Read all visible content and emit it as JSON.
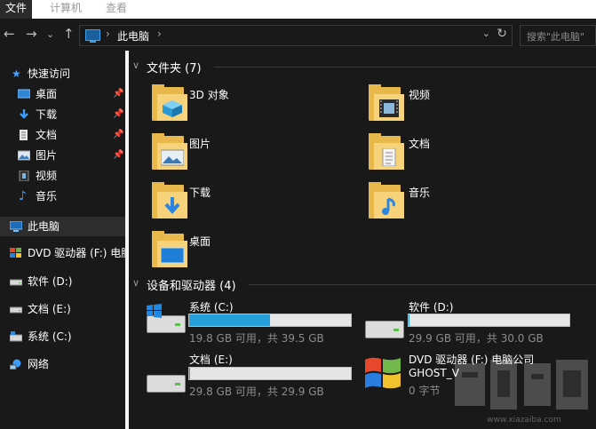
{
  "ribbon": {
    "tabs": [
      "文件",
      "计算机",
      "查看"
    ]
  },
  "navbar": {
    "back": "←",
    "forward": "→",
    "recent": "⌄",
    "up": "↑",
    "address_sep": "›",
    "address_crumb": "此电脑",
    "address_sep2": "›",
    "dropdown": "⌄",
    "refresh": "↻",
    "search_placeholder": "搜索\"此电脑\""
  },
  "sidebar": {
    "quick_access": "快速访问",
    "items": [
      {
        "label": "桌面",
        "icon": "desktop-icon",
        "pinned": true
      },
      {
        "label": "下载",
        "icon": "download-icon",
        "pinned": true
      },
      {
        "label": "文档",
        "icon": "document-icon",
        "pinned": true
      },
      {
        "label": "图片",
        "icon": "picture-icon",
        "pinned": true
      },
      {
        "label": "视频",
        "icon": "video-icon",
        "pinned": false
      },
      {
        "label": "音乐",
        "icon": "music-icon",
        "pinned": false
      }
    ],
    "this_pc": "此电脑",
    "drives": [
      {
        "label": "DVD 驱动器 (F:) 电脑",
        "icon": "dvd-icon"
      },
      {
        "label": "软件 (D:)",
        "icon": "drive-icon"
      },
      {
        "label": "文档 (E:)",
        "icon": "drive-icon"
      },
      {
        "label": "系统 (C:)",
        "icon": "system-drive-icon"
      },
      {
        "label": "网络",
        "icon": "network-icon"
      }
    ],
    "pin_glyph": "📌"
  },
  "folders_section": {
    "title": "文件夹 (7)",
    "chevron": "∨",
    "items": [
      "3D 对象",
      "视频",
      "图片",
      "文档",
      "下载",
      "音乐",
      "桌面"
    ]
  },
  "drives_section": {
    "title": "设备和驱动器 (4)",
    "chevron": "∨",
    "items": [
      {
        "name": "系统 (C:)",
        "info": "19.8 GB 可用，共 39.5 GB",
        "used_fraction": 0.5
      },
      {
        "name": "软件 (D:)",
        "info": "29.9 GB 可用，共 30.0 GB",
        "used_fraction": 0.003
      },
      {
        "name": "文档 (E:)",
        "info": "29.8 GB 可用，共 29.9 GB",
        "used_fraction": 0.003
      },
      {
        "name": "DVD 驱动器 (F:) 电脑公司",
        "name2": "GHOST_V",
        "info": "0 字节"
      }
    ]
  },
  "colors": {
    "accent": "#26a0da",
    "folder": "#e8b94a",
    "background": "#191919"
  }
}
